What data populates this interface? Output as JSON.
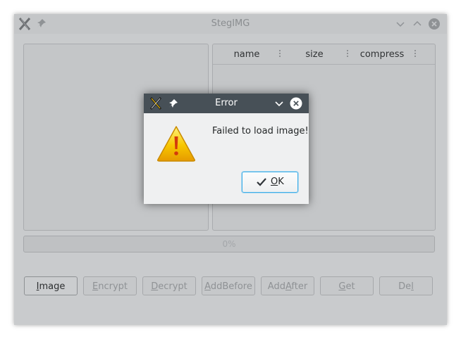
{
  "main_window": {
    "title": "StegIMG",
    "table_headers": [
      "name",
      "size",
      "compress"
    ],
    "progress": {
      "value": 0,
      "text": "0%"
    },
    "buttons": [
      {
        "mnemonic": "I",
        "rest": "mage",
        "enabled": true
      },
      {
        "mnemonic": "E",
        "rest": "ncrypt",
        "enabled": false
      },
      {
        "mnemonic": "D",
        "rest": "ecrypt",
        "enabled": false
      },
      {
        "mnemonic": "A",
        "rest": "ddBefore",
        "enabled": false
      },
      {
        "pre": "Add",
        "mnemonic": "A",
        "rest": "fter",
        "enabled": false
      },
      {
        "mnemonic": "G",
        "rest": "et",
        "enabled": false
      },
      {
        "pre": "De",
        "mnemonic": "l",
        "rest": "",
        "enabled": false
      }
    ]
  },
  "dialog": {
    "title": "Error",
    "message": "Failed to load image!",
    "ok_mnemonic": "O",
    "ok_rest": "K",
    "icon": "warning-icon"
  },
  "colors": {
    "dialog_titlebar": "#475057",
    "focus_accent": "#3daee9",
    "warning_fill": "#f7c600"
  }
}
